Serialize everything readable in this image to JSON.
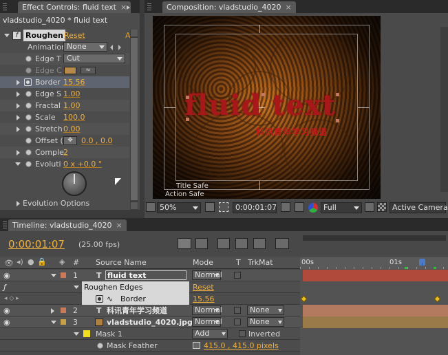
{
  "effect_controls": {
    "tab_title": "Effect Controls: fluid text",
    "breadcrumb": "vladstudio_4020 * fluid text",
    "fx_badge": "f",
    "effect_name": "Roughen",
    "reset": "Reset",
    "about": "A",
    "rows": [
      {
        "label": "Animation",
        "value": "None",
        "type": "dropdown"
      },
      {
        "label": "Edge T",
        "value": "Cut",
        "type": "dropdown"
      },
      {
        "label": "Edge C",
        "value": "",
        "type": "color",
        "dim": true
      },
      {
        "label": "Border",
        "value": "15.56",
        "type": "value"
      },
      {
        "label": "Edge S",
        "value": "1.00",
        "type": "value"
      },
      {
        "label": "Fractal",
        "value": "1.00",
        "type": "value"
      },
      {
        "label": "Scale",
        "value": "100.0",
        "type": "value"
      },
      {
        "label": "Stretch",
        "value": "0.00",
        "type": "value"
      },
      {
        "label": "Offset (",
        "value": "0.0 , 0.0",
        "type": "point"
      },
      {
        "label": "Comple",
        "value": "2",
        "type": "value"
      },
      {
        "label": "Evoluti",
        "value": "0 x +0.0 °",
        "type": "value"
      }
    ],
    "evolution_options": "Evolution Options"
  },
  "composition": {
    "tab_title": "Composition: vladstudio_4020",
    "text_main": "fluid text",
    "text_cn": "科讯青年学习频道",
    "title_safe": "Title Safe",
    "action_safe": "Action Safe",
    "zoom": "50%",
    "timecode": "0:00:01:07",
    "resolution": "Full",
    "camera": "Active Camera"
  },
  "timeline": {
    "tab_title": "Timeline: vladstudio_4020",
    "timecode": "0:00:01:07",
    "fps": "(25.00 fps)",
    "ruler_labels": [
      "00s",
      "01s"
    ],
    "headers": {
      "num": "#",
      "source_name": "Source Name",
      "mode": "Mode",
      "t": "T",
      "trkmat": "TrkMat"
    },
    "layers": [
      {
        "num": "1",
        "name": "fluid text",
        "mode": "Normal",
        "trkmat": "",
        "color": "#c87a5a"
      },
      {
        "num": "2",
        "name": "科讯青年学习频道",
        "mode": "Normal",
        "trkmat": "None",
        "color": "#c87a5a"
      },
      {
        "num": "3",
        "name": "vladstudio_4020.jpg",
        "mode": "Normal",
        "trkmat": "None",
        "color": "#c8a048"
      }
    ],
    "sub_rows": {
      "effect": "Roughen Edges",
      "effect_reset": "Reset",
      "border_label": "Border",
      "border_value": "15.56",
      "mask_label": "Mask 1",
      "mask_mode": "Add",
      "mask_inverted": "Inverted",
      "mask_feather_label": "Mask Feather",
      "mask_feather_value": "415.0 , 415.0 pixels"
    }
  },
  "colors": {
    "accent_value": "#f0b040",
    "text_red": "#a8181a",
    "timecode": "#f0b040"
  }
}
